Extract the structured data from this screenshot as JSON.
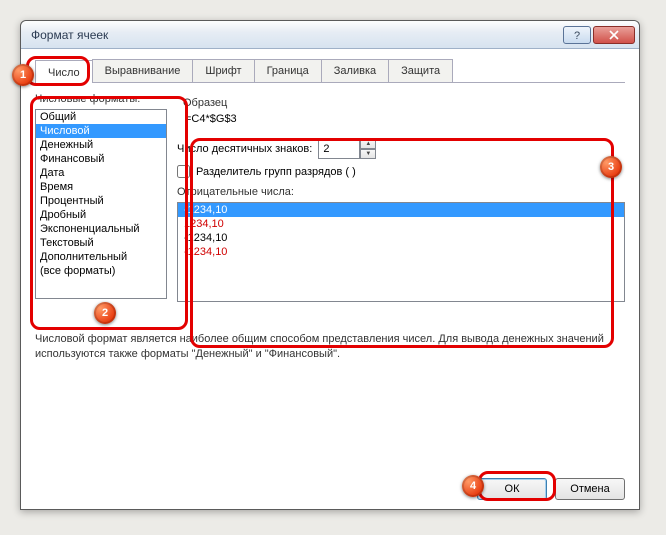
{
  "window": {
    "title": "Формат ячеек"
  },
  "tabs": {
    "items": [
      "Число",
      "Выравнивание",
      "Шрифт",
      "Граница",
      "Заливка",
      "Защита"
    ]
  },
  "left": {
    "label": "Числовые форматы:",
    "items": [
      "Общий",
      "Числовой",
      "Денежный",
      "Финансовый",
      "Дата",
      "Время",
      "Процентный",
      "Дробный",
      "Экспоненциальный",
      "Текстовый",
      "Дополнительный",
      "(все форматы)"
    ]
  },
  "right": {
    "sample_label": "Образец",
    "sample_value": "=C4*$G$3",
    "decimals_label": "Число десятичных знаков:",
    "decimals_value": "2",
    "separator_label": "Разделитель групп разрядов ( )",
    "neg_label": "Отрицательные числа:",
    "neg_items": [
      {
        "text": "-1234,10",
        "color": "#fff",
        "sel": true
      },
      {
        "text": "1234,10",
        "color": "#d00000"
      },
      {
        "text": "-1234,10",
        "color": "#000"
      },
      {
        "text": "-1234,10",
        "color": "#d00000"
      }
    ]
  },
  "hint": "Числовой формат является наиболее общим способом представления чисел. Для вывода денежных значений используются также форматы \"Денежный\" и \"Финансовый\".",
  "footer": {
    "ok": "ОК",
    "cancel": "Отмена"
  },
  "badges": {
    "b1": "1",
    "b2": "2",
    "b3": "3",
    "b4": "4"
  }
}
